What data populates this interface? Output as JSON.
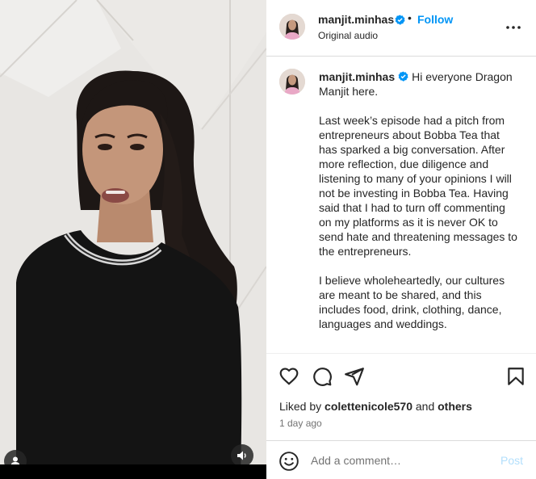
{
  "post": {
    "username": "manjit.minhas",
    "verified": true,
    "separator": "•",
    "follow_label": "Follow",
    "audio_label": "Original audio",
    "caption": "Hi everyone Dragon Manjit here.\n\nLast week’s episode had a pitch from entrepreneurs about Bobba Tea that has sparked a big conversation. After more reflection, due diligence and listening to many of your opinions I will not be investing in Bobba Tea. Having said that I had to turn off commenting on my platforms as it is never OK to send hate and threatening messages to the entrepreneurs.\n\nI believe wholeheartedly, our cultures are meant to be shared, and this includes food, drink, clothing, dance, languages and weddings.",
    "liked_by_prefix": "Liked by",
    "liked_by_user": "colettenicole570",
    "liked_by_and": "and",
    "liked_by_others": "others",
    "time_ago": "1 day ago"
  },
  "comment_bar": {
    "placeholder": "Add a comment…",
    "post_label": "Post"
  },
  "icons": {
    "like": "heart-icon",
    "comment": "comment-bubble-icon",
    "share": "paper-plane-icon",
    "save": "bookmark-icon",
    "more": "more-options-icon",
    "tag": "user-tag-icon",
    "audio": "speaker-icon",
    "emoji": "emoji-smile-icon",
    "verified": "verified-badge-icon"
  },
  "colors": {
    "accent": "#0095f6",
    "verified": "#0095f6",
    "post_disabled": "#b2dffc",
    "text": "#262626",
    "muted": "#737373"
  }
}
